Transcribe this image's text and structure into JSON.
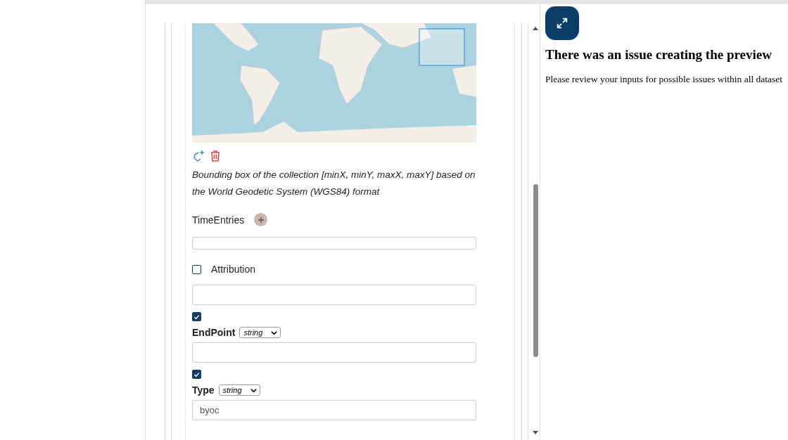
{
  "form": {
    "description": "Bounding box of the collection [minX, minY, maxX, maxY] based on the World Geodetic System (WGS84) format",
    "fields": [
      {
        "kind": "list",
        "label": "TimeEntries"
      },
      {
        "kind": "optional",
        "label": "Attribution",
        "checked": false
      },
      {
        "kind": "typed",
        "label": "EndPoint",
        "checked": true,
        "type": "string"
      },
      {
        "kind": "typed",
        "label": "Type",
        "checked": true,
        "type": "string",
        "value": "byoc"
      }
    ]
  },
  "preview": {
    "title": "There was an issue creating the preview",
    "message": "Please review your inputs for possible issues within all dataset"
  }
}
